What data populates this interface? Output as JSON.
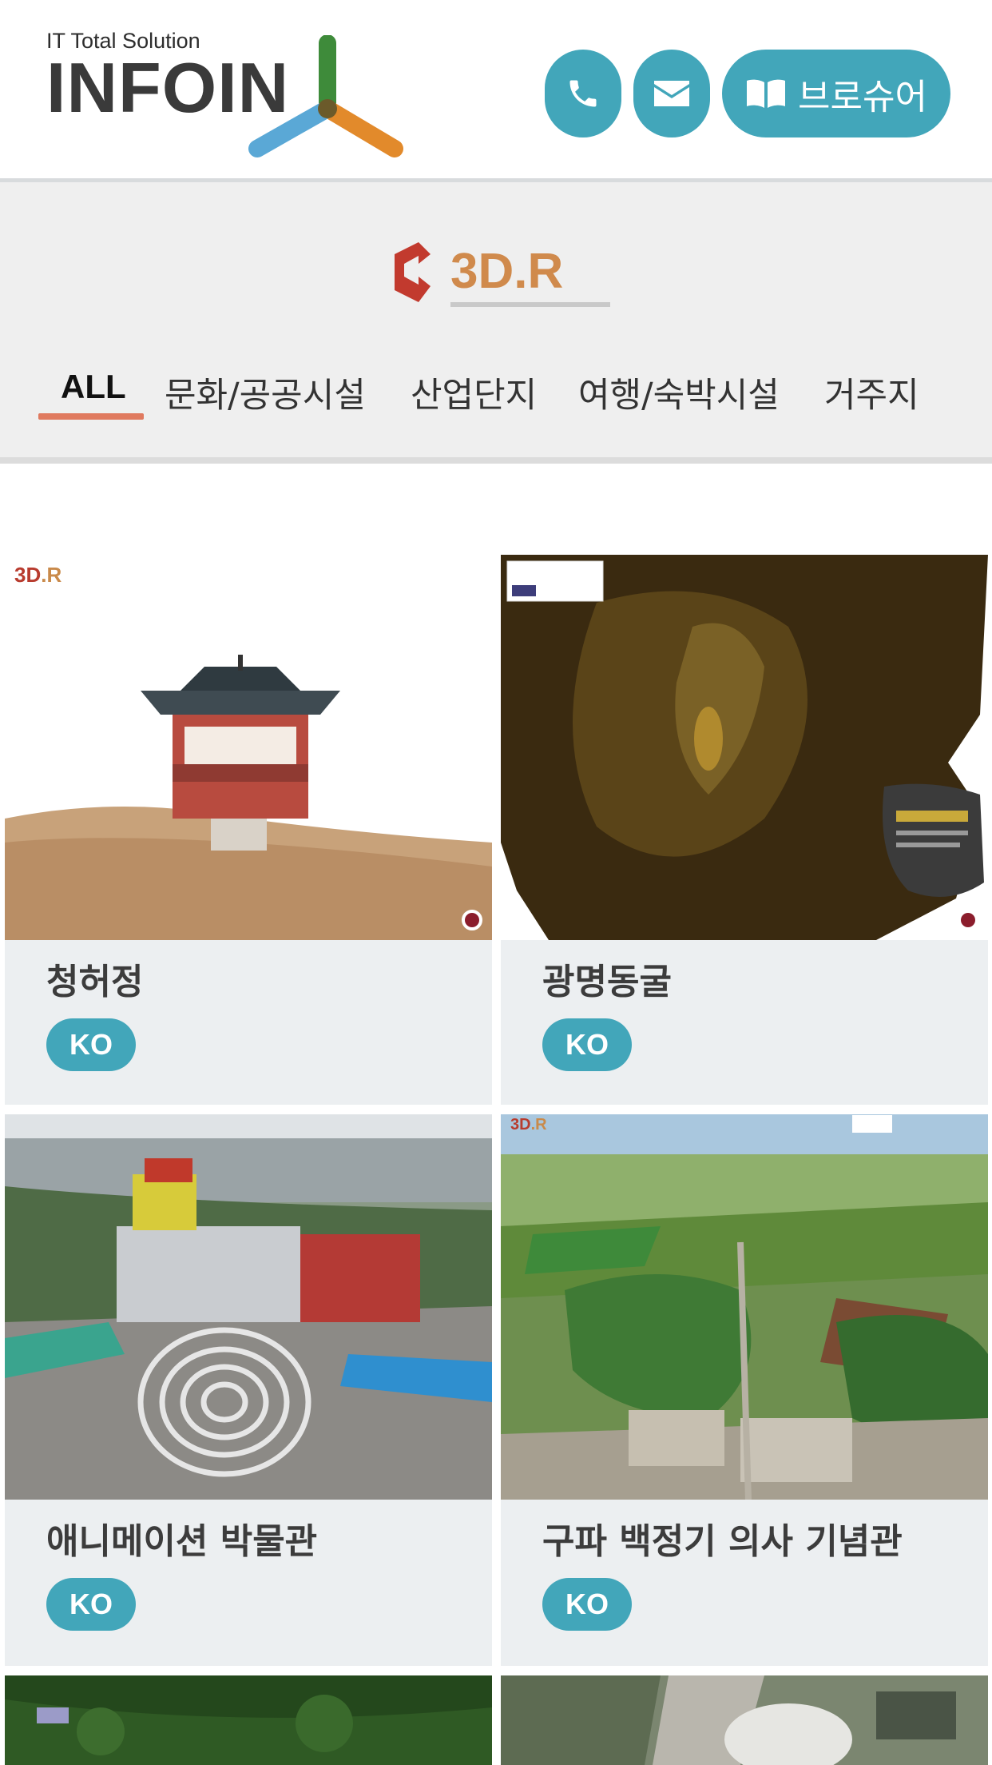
{
  "header": {
    "tagline": "IT Total Solution",
    "brand": "INFOIN",
    "phone_icon": "phone-icon",
    "mail_icon": "envelope-icon",
    "brochure_icon": "book-icon",
    "brochure_label": "브로슈어",
    "accent": "#42a6ba"
  },
  "subheader": {
    "brand_logo_text": "3D.R",
    "tabs": [
      "ALL",
      "문화/공공시설",
      "산업단지",
      "여행/숙박시설",
      "거주지"
    ],
    "active_tab": "ALL",
    "underline_color": "#e07a5f"
  },
  "cards": [
    {
      "title": "청허정",
      "lang": "KO"
    },
    {
      "title": "광명동굴",
      "lang": "KO"
    },
    {
      "title": "애니메이션 박물관",
      "lang": "KO"
    },
    {
      "title": "구파 백정기 의사 기념관",
      "lang": "KO"
    }
  ]
}
